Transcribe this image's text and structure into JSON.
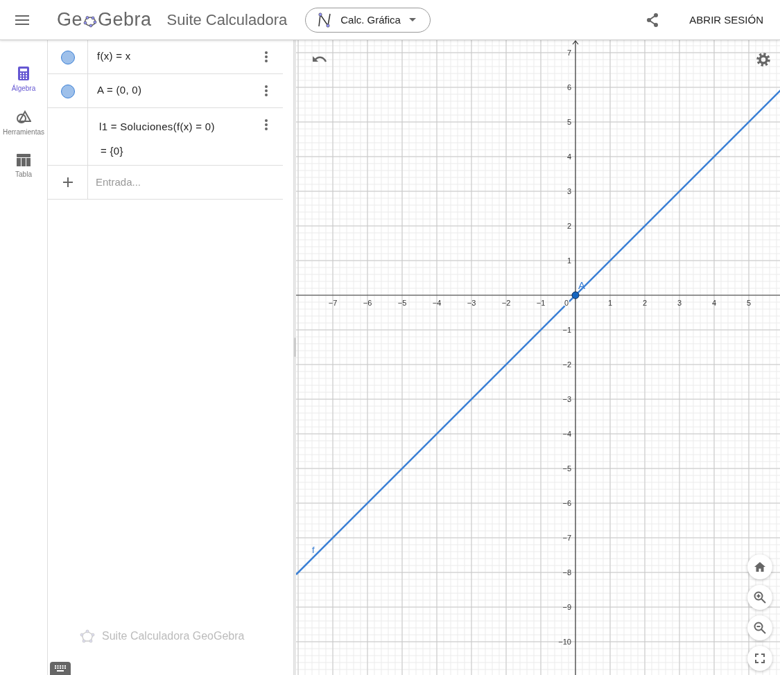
{
  "header": {
    "logo_parts": [
      "Ge",
      "Gebra"
    ],
    "app_title": "Suite Calculadora",
    "app_switcher": "Calc. Gráfica",
    "sign_in": "ABRIR SESIÓN"
  },
  "sidebar": {
    "items": [
      {
        "label": "Álgebra",
        "kind": "calculator",
        "selected": true
      },
      {
        "label": "Herramientas",
        "kind": "tools",
        "selected": false
      },
      {
        "label": "Tabla",
        "kind": "table",
        "selected": false
      }
    ]
  },
  "algebra": {
    "rows": [
      {
        "kind": "object",
        "visible": true,
        "input": "f(x) = x"
      },
      {
        "kind": "object",
        "visible": true,
        "input": "A = (0, 0)"
      },
      {
        "kind": "command",
        "input": "l1 = Soluciones(f(x) = 0)",
        "output": "=  {0}"
      }
    ],
    "input_placeholder": "Entrada...",
    "footer": "Suite Calculadora GeoGebra"
  },
  "graphics": {
    "chart_data": {
      "type": "line",
      "x": [
        -8.06,
        5.94
      ],
      "series": [
        {
          "name": "f",
          "color": "#3a7fd5",
          "values": [
            -8.06,
            5.94
          ]
        }
      ],
      "xlim": [
        -8.06,
        5.94
      ],
      "ylim": [
        -10.96,
        7.36
      ],
      "xticks": [
        -7,
        -6,
        -5,
        -4,
        -3,
        -2,
        -1,
        1,
        2,
        3,
        4,
        5
      ],
      "yticks": [
        -10,
        -9,
        -8,
        -7,
        -6,
        -5,
        -4,
        -3,
        -2,
        -1,
        1,
        2,
        3,
        4,
        5,
        6,
        7
      ],
      "annotations": [
        {
          "text": "A",
          "x": 0,
          "y": 0
        }
      ],
      "grid": true
    },
    "origin_label": "0"
  }
}
